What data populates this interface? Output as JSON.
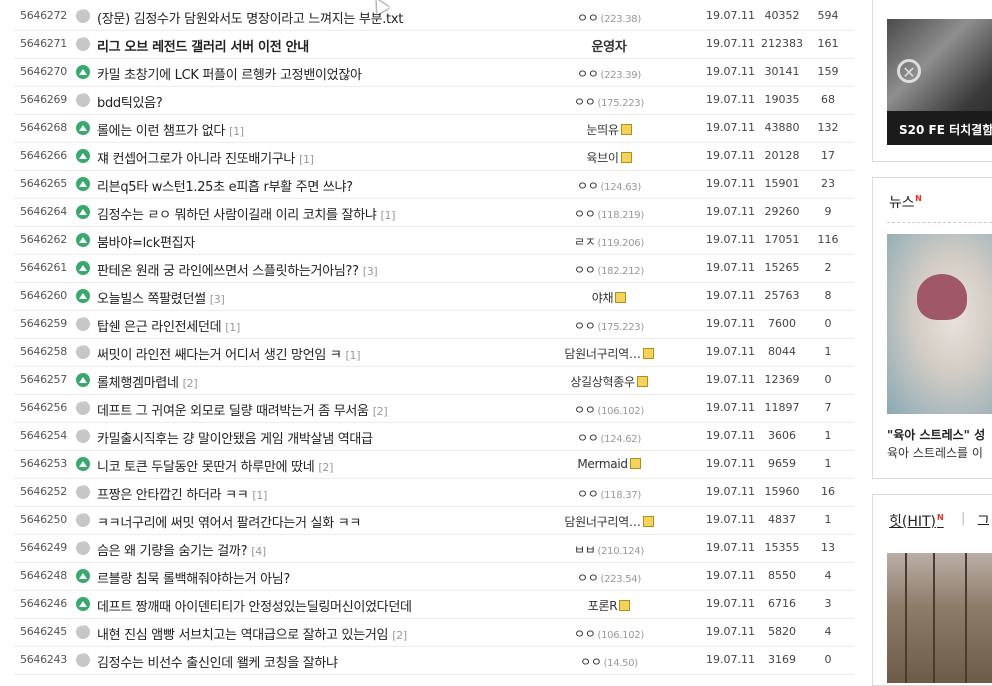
{
  "posts": [
    {
      "num": "5646272",
      "icon": "text",
      "title": "(장문) 김정수가 담원와서도 명장이라고 느껴지는 부분.txt",
      "reply": "",
      "writer": "ㅇㅇ",
      "ip": "(223.38)",
      "badge": false,
      "bold": false,
      "date": "19.07.11",
      "views": "40352",
      "rec": "594"
    },
    {
      "num": "5646271",
      "icon": "text",
      "title": "리그 오브 레전드 갤러리 서버 이전 안내",
      "reply": "",
      "writer": "운영자",
      "ip": "",
      "badge": false,
      "bold": true,
      "date": "19.07.11",
      "views": "212383",
      "rec": "161"
    },
    {
      "num": "5646270",
      "icon": "image",
      "title": "카밀 초창기에 LCK 퍼플이 르헹카 고정밴이었잖아",
      "reply": "",
      "writer": "ㅇㅇ",
      "ip": "(223.39)",
      "badge": false,
      "bold": false,
      "date": "19.07.11",
      "views": "30141",
      "rec": "159"
    },
    {
      "num": "5646269",
      "icon": "text",
      "title": "bdd틱있음?",
      "reply": "",
      "writer": "ㅇㅇ",
      "ip": "(175.223)",
      "badge": false,
      "bold": false,
      "date": "19.07.11",
      "views": "19035",
      "rec": "68"
    },
    {
      "num": "5646268",
      "icon": "image",
      "title": "롤에는 이런 챔프가 없다",
      "reply": "[1]",
      "writer": "눈띄유",
      "ip": "",
      "badge": true,
      "bold": false,
      "date": "19.07.11",
      "views": "43880",
      "rec": "132"
    },
    {
      "num": "5646266",
      "icon": "image",
      "title": "쟤 컨셉어그로가 아니라 진또배기구나",
      "reply": "[1]",
      "writer": "육브이",
      "ip": "",
      "badge": true,
      "bold": false,
      "date": "19.07.11",
      "views": "20128",
      "rec": "17"
    },
    {
      "num": "5646265",
      "icon": "image",
      "title": "리븐q5타 w스턴1.25초 e피흡 r부활 주면 쓰냐?",
      "reply": "",
      "writer": "ㅇㅇ",
      "ip": "(124.63)",
      "badge": false,
      "bold": false,
      "date": "19.07.11",
      "views": "15901",
      "rec": "23"
    },
    {
      "num": "5646264",
      "icon": "image",
      "title": "김정수는 ㄹㅇ 뭐하던 사람이길래 이리 코치를 잘하냐",
      "reply": "[1]",
      "writer": "ㅇㅇ",
      "ip": "(118.219)",
      "badge": false,
      "bold": false,
      "date": "19.07.11",
      "views": "29260",
      "rec": "9"
    },
    {
      "num": "5646262",
      "icon": "image",
      "title": "붐바야=lck편집자",
      "reply": "",
      "writer": "ㄹㅈ",
      "ip": "(119.206)",
      "badge": false,
      "bold": false,
      "date": "19.07.11",
      "views": "17051",
      "rec": "116"
    },
    {
      "num": "5646261",
      "icon": "image",
      "title": "판테온 원래 궁 라인에쓰면서 스플릿하는거아님??",
      "reply": "[3]",
      "writer": "ㅇㅇ",
      "ip": "(182.212)",
      "badge": false,
      "bold": false,
      "date": "19.07.11",
      "views": "15265",
      "rec": "2"
    },
    {
      "num": "5646260",
      "icon": "image",
      "title": "오늘빌스 쪽팔렸던썰",
      "reply": "[3]",
      "writer": "야채",
      "ip": "",
      "badge": true,
      "bold": false,
      "date": "19.07.11",
      "views": "25763",
      "rec": "8"
    },
    {
      "num": "5646259",
      "icon": "text",
      "title": "탑쉔 은근 라인전세던데",
      "reply": "[1]",
      "writer": "ㅇㅇ",
      "ip": "(175.223)",
      "badge": false,
      "bold": false,
      "date": "19.07.11",
      "views": "7600",
      "rec": "0"
    },
    {
      "num": "5646258",
      "icon": "text",
      "title": "써밋이 라인전 쌔다는거 어디서 생긴 망언임 ㅋ",
      "reply": "[1]",
      "writer": "담원너구리역…",
      "ip": "",
      "badge": true,
      "bold": false,
      "date": "19.07.11",
      "views": "8044",
      "rec": "1"
    },
    {
      "num": "5646257",
      "icon": "image",
      "title": "롤체행겜마렵네",
      "reply": "[2]",
      "writer": "상길상혁종우",
      "ip": "",
      "badge": true,
      "bold": false,
      "date": "19.07.11",
      "views": "12369",
      "rec": "0"
    },
    {
      "num": "5646256",
      "icon": "text",
      "title": "데프트 그 귀여운 외모로 딜량 때려박는거 좀 무서움",
      "reply": "[2]",
      "writer": "ㅇㅇ",
      "ip": "(106.102)",
      "badge": false,
      "bold": false,
      "date": "19.07.11",
      "views": "11897",
      "rec": "7"
    },
    {
      "num": "5646254",
      "icon": "text",
      "title": "카밀출시직후는 걍 말이안됐음 게임 개박살냄 역대급",
      "reply": "",
      "writer": "ㅇㅇ",
      "ip": "(124.62)",
      "badge": false,
      "bold": false,
      "date": "19.07.11",
      "views": "3606",
      "rec": "1"
    },
    {
      "num": "5646253",
      "icon": "image",
      "title": "니코 토큰 두달동안 못딴거 하루만에 땄네",
      "reply": "[2]",
      "writer": "Mermaid",
      "ip": "",
      "badge": true,
      "bold": false,
      "date": "19.07.11",
      "views": "9659",
      "rec": "1"
    },
    {
      "num": "5646252",
      "icon": "text",
      "title": "프짱은 안타깝긴 하더라 ㅋㅋ",
      "reply": "[1]",
      "writer": "ㅇㅇ",
      "ip": "(118.37)",
      "badge": false,
      "bold": false,
      "date": "19.07.11",
      "views": "15960",
      "rec": "16"
    },
    {
      "num": "5646250",
      "icon": "text",
      "title": "ㅋㅋ너구리에 써밋 엮어서 팔려간다는거 실화 ㅋㅋ",
      "reply": "",
      "writer": "담원너구리역…",
      "ip": "",
      "badge": true,
      "bold": false,
      "date": "19.07.11",
      "views": "4837",
      "rec": "1"
    },
    {
      "num": "5646249",
      "icon": "text",
      "title": "슴은 왜 기량을 숨기는 걸까?",
      "reply": "[4]",
      "writer": "ㅂㅂ",
      "ip": "(210.124)",
      "badge": false,
      "bold": false,
      "date": "19.07.11",
      "views": "15355",
      "rec": "13"
    },
    {
      "num": "5646248",
      "icon": "image",
      "title": "르블랑 침묵 롤백해줘야하는거 아님?",
      "reply": "",
      "writer": "ㅇㅇ",
      "ip": "(223.54)",
      "badge": false,
      "bold": false,
      "date": "19.07.11",
      "views": "8550",
      "rec": "4"
    },
    {
      "num": "5646246",
      "icon": "image",
      "title": "데프트 짱깨때 아이덴티티가 안정성있는딜링머신이었다던데",
      "reply": "",
      "writer": "포론R",
      "ip": "",
      "badge": true,
      "bold": false,
      "date": "19.07.11",
      "views": "6716",
      "rec": "3"
    },
    {
      "num": "5646245",
      "icon": "text",
      "title": "내현 진심 앰빵 서브치고는 역대급으로 잘하고 있는거임",
      "reply": "[2]",
      "writer": "ㅇㅇ",
      "ip": "(106.102)",
      "badge": false,
      "bold": false,
      "date": "19.07.11",
      "views": "5820",
      "rec": "4"
    },
    {
      "num": "5646243",
      "icon": "text",
      "title": "김정수는 비선수 출신인데 왤케 코칭을 잘하냐",
      "reply": "",
      "writer": "ㅇㅇ",
      "ip": "(14.50)",
      "badge": false,
      "bold": false,
      "date": "19.07.11",
      "views": "3169",
      "rec": "0"
    }
  ],
  "sidebar": {
    "game_caption": "S20 FE 터치결함",
    "news_title": "뉴스",
    "new_mark": "N",
    "news_headline": "\"육아 스트레스\" 성",
    "news_sub": "육아 스트레스를 이",
    "hit_tab": "힛(HIT)",
    "hit_sep": "|",
    "hit_tab2": "그"
  }
}
